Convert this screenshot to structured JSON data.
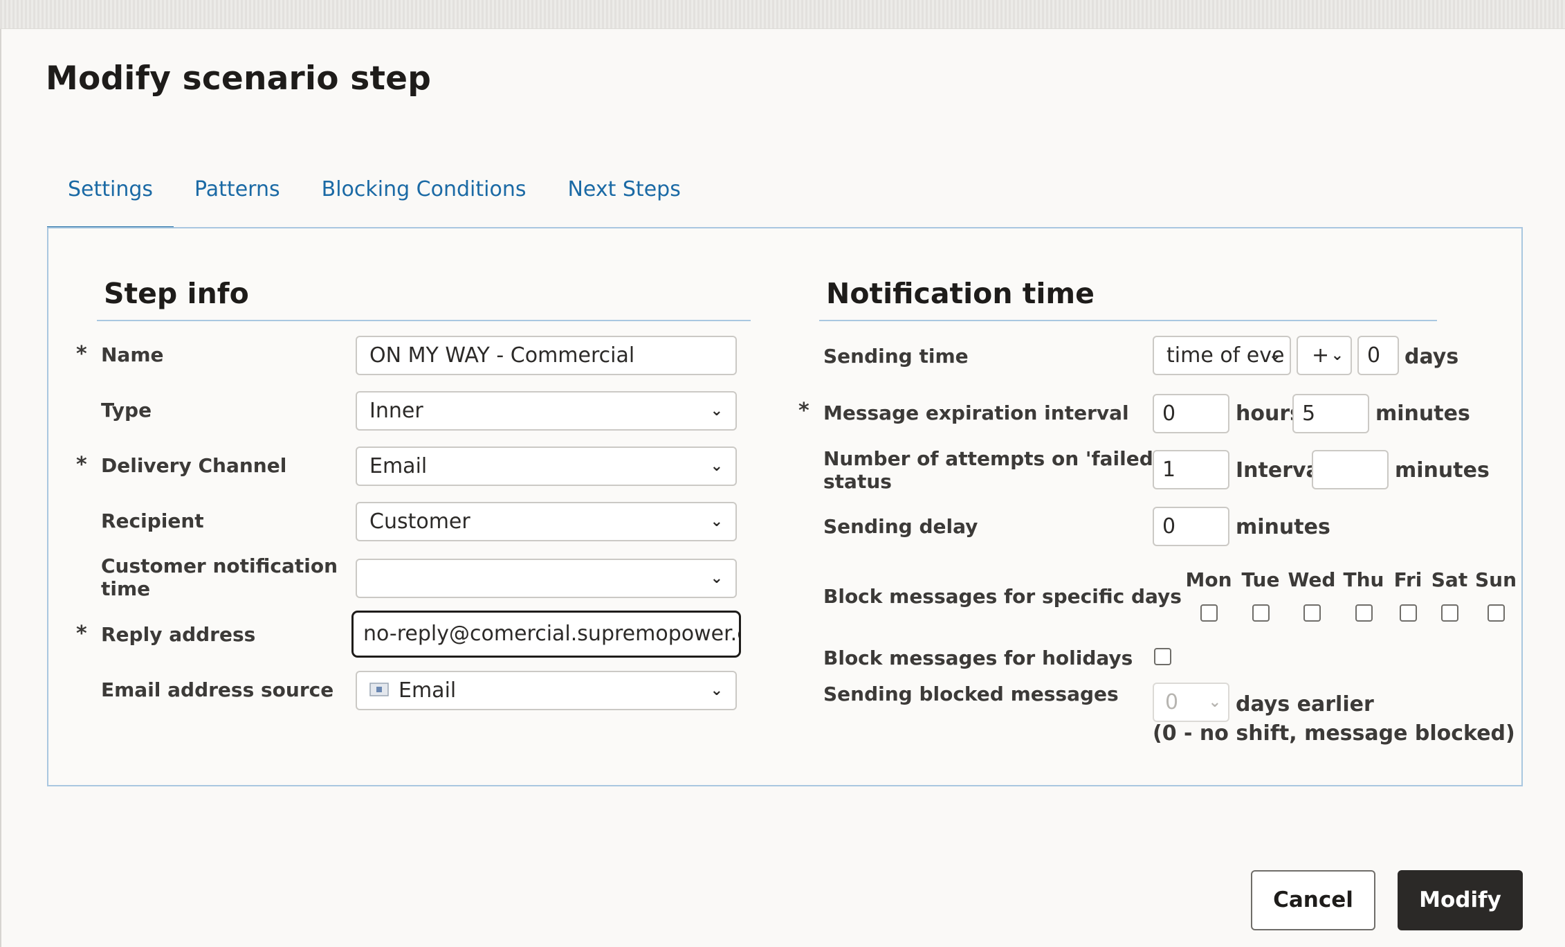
{
  "dialog": {
    "title": "Modify scenario step",
    "tabs": [
      "Settings",
      "Patterns",
      "Blocking Conditions",
      "Next Steps"
    ],
    "active_tab": "Settings"
  },
  "step_info": {
    "heading": "Step info",
    "required_marker": "*",
    "name": {
      "label": "Name",
      "value": "ON MY WAY - Commercial"
    },
    "type": {
      "label": "Type",
      "value": "Inner"
    },
    "delivery_channel": {
      "label": "Delivery Channel",
      "value": "Email"
    },
    "recipient": {
      "label": "Recipient",
      "value": "Customer"
    },
    "customer_notification_time": {
      "label_line1": "Customer notification",
      "label_line2": "time",
      "value": ""
    },
    "reply_address": {
      "label": "Reply address",
      "value": "no-reply@comercial.supremopower.com"
    },
    "email_address_source": {
      "label": "Email address source",
      "value": "Email"
    }
  },
  "notification_time": {
    "heading": "Notification time",
    "sending_time": {
      "label": "Sending time",
      "base": "time of eve",
      "sign": "+",
      "days_value": "0",
      "days_unit": "days"
    },
    "message_expiration": {
      "label": "Message expiration interval",
      "hours_value": "0",
      "hours_unit": "hours",
      "minutes_value": "5",
      "minutes_unit": "minutes"
    },
    "failed_attempts": {
      "label_line1": "Number of attempts on 'failed'",
      "label_line2": "status",
      "value": "1",
      "interval_label": "Interval",
      "interval_value": "",
      "interval_unit": "minutes"
    },
    "sending_delay": {
      "label": "Sending delay",
      "value": "0",
      "unit": "minutes"
    },
    "block_days": {
      "label": "Block messages for specific days",
      "days": [
        "Mon",
        "Tue",
        "Wed",
        "Thu",
        "Fri",
        "Sat",
        "Sun"
      ],
      "checked": [
        false,
        false,
        false,
        false,
        false,
        false,
        false
      ]
    },
    "block_holidays": {
      "label": "Block messages for holidays",
      "checked": false
    },
    "sending_blocked": {
      "label": "Sending blocked messages",
      "value": "0",
      "unit": "days earlier",
      "note": "(0 - no shift, message blocked)"
    }
  },
  "actions": {
    "cancel": "Cancel",
    "modify": "Modify"
  },
  "colors": {
    "accent": "#1b6aa5",
    "primary_button": "#2b2927",
    "panel_border": "#a9c7e0"
  }
}
